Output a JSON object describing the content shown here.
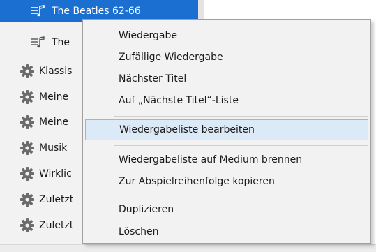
{
  "sidebar": {
    "items": [
      {
        "type": "playlist",
        "label": "The Beatles 62-66",
        "selected": true
      },
      {
        "type": "playlist",
        "label": "The",
        "selected": false
      },
      {
        "type": "smart",
        "label": "Klassis",
        "selected": false
      },
      {
        "type": "smart",
        "label": "Meine",
        "selected": false
      },
      {
        "type": "smart",
        "label": "Meine",
        "selected": false
      },
      {
        "type": "smart",
        "label": "Musik",
        "selected": false
      },
      {
        "type": "smart",
        "label": "Wirklic",
        "selected": false
      },
      {
        "type": "smart",
        "label": "Zuletzt",
        "selected": false
      },
      {
        "type": "smart",
        "label": "Zuletzt",
        "selected": false
      }
    ]
  },
  "context_menu": {
    "groups": [
      [
        "Wiedergabe",
        "Zufällige Wiedergabe",
        "Nächster Titel",
        "Auf „Nächste Titel“-Liste"
      ],
      [
        "Wiedergabeliste bearbeiten"
      ],
      [
        "Wiedergabeliste auf Medium brennen",
        "Zur Abspielreihenfolge kopieren"
      ],
      [
        "Duplizieren",
        "Löschen"
      ]
    ],
    "hovered_item": "Wiedergabeliste bearbeiten"
  },
  "icons": {
    "playlist": "music-list-icon",
    "smart": "gear-icon"
  },
  "colors": {
    "selection": "#1a6fd1",
    "menu_background": "#f2f2f2",
    "menu_hover": "#dce9f7",
    "menu_hover_border": "#94b8e0"
  }
}
